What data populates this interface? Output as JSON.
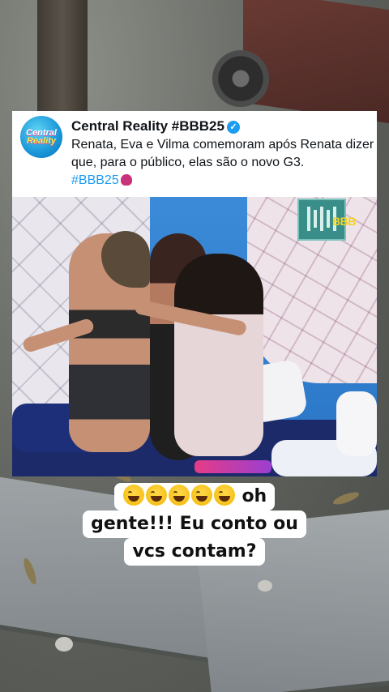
{
  "tweet": {
    "author_name": "Central Reality #BBB25",
    "avatar_text_top": "Central",
    "avatar_text_bottom": "Reality",
    "text": "Renata, Eva e Vilma comemoram após Renata dizer que, para o público, elas são o novo G3.",
    "hashtag": "#BBB25",
    "verified_color": "#1d9bf0"
  },
  "photo": {
    "logo_text": "BBB"
  },
  "caption": {
    "emoji_count": 5,
    "emoji_name": "grinning-squinting-face",
    "line1_text": "oh",
    "line2_text": "gente!!! Eu conto ou",
    "line3_text": "vcs contam?"
  },
  "colors": {
    "accent_blue": "#1d9bf0",
    "card_bg": "#ffffff",
    "logo_yellow": "#f4d21e"
  }
}
